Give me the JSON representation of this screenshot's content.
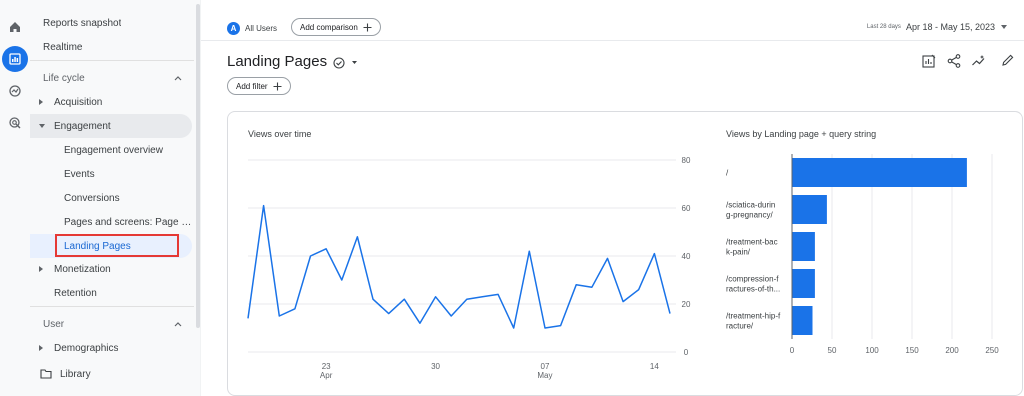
{
  "rail": {
    "icons": [
      "home-icon",
      "reports-icon",
      "explore-icon",
      "advertising-icon"
    ]
  },
  "sidebar": {
    "reports_snapshot": "Reports snapshot",
    "realtime": "Realtime",
    "life_cycle": "Life cycle",
    "acquisition": "Acquisition",
    "engagement": "Engagement",
    "engagement_overview": "Engagement overview",
    "events": "Events",
    "conversions": "Conversions",
    "pages_and_screens": "Pages and screens: Page ti...",
    "landing_pages": "Landing Pages",
    "monetization": "Monetization",
    "retention": "Retention",
    "user": "User",
    "demographics": "Demographics",
    "library": "Library"
  },
  "header": {
    "avatar_letter": "A",
    "all_users": "All Users",
    "add_comparison": "Add comparison",
    "date_prefix": "Last 28 days",
    "date_range": "Apr 18 - May 15, 2023",
    "page_title": "Landing Pages",
    "add_filter": "Add filter"
  },
  "chart_data": [
    {
      "type": "line",
      "title": "Views over time",
      "x": [
        "Apr 18",
        "Apr 19",
        "Apr 20",
        "Apr 21",
        "Apr 22",
        "Apr 23",
        "Apr 24",
        "Apr 25",
        "Apr 26",
        "Apr 27",
        "Apr 28",
        "Apr 29",
        "Apr 30",
        "May 1",
        "May 2",
        "May 3",
        "May 4",
        "May 5",
        "May 6",
        "May 7",
        "May 8",
        "May 9",
        "May 10",
        "May 11",
        "May 12",
        "May 13",
        "May 14",
        "May 15"
      ],
      "series": [
        {
          "values": [
            14,
            61,
            15,
            18,
            40,
            43,
            30,
            48,
            22,
            16,
            22,
            12,
            23,
            15,
            22,
            23,
            24,
            10,
            42,
            10,
            11,
            28,
            27,
            39,
            21,
            26,
            41,
            16
          ]
        }
      ],
      "ylim": [
        0,
        80
      ],
      "yticks": [
        "80",
        "60",
        "40",
        "20",
        "0"
      ],
      "xticks": [
        {
          "top": "23",
          "bottom": "Apr"
        },
        {
          "top": "30",
          "bottom": ""
        },
        {
          "top": "07",
          "bottom": "May"
        },
        {
          "top": "14",
          "bottom": ""
        }
      ],
      "color": "#1a73e8"
    },
    {
      "type": "bar",
      "title": "Views by Landing page + query string",
      "categories": [
        [
          "/"
        ],
        [
          "/sciatica-durin",
          "g-pregnancy/"
        ],
        [
          "/treatment-bac",
          "k-pain/"
        ],
        [
          "/compression-f",
          "ractures-of-th..."
        ],
        [
          "/treatment-hip-f",
          "racture/"
        ]
      ],
      "values": [
        218,
        43,
        28,
        28,
        25
      ],
      "xlim": [
        0,
        250
      ],
      "xticks": [
        "0",
        "50",
        "100",
        "150",
        "200",
        "250"
      ],
      "color": "#1a73e8"
    }
  ]
}
